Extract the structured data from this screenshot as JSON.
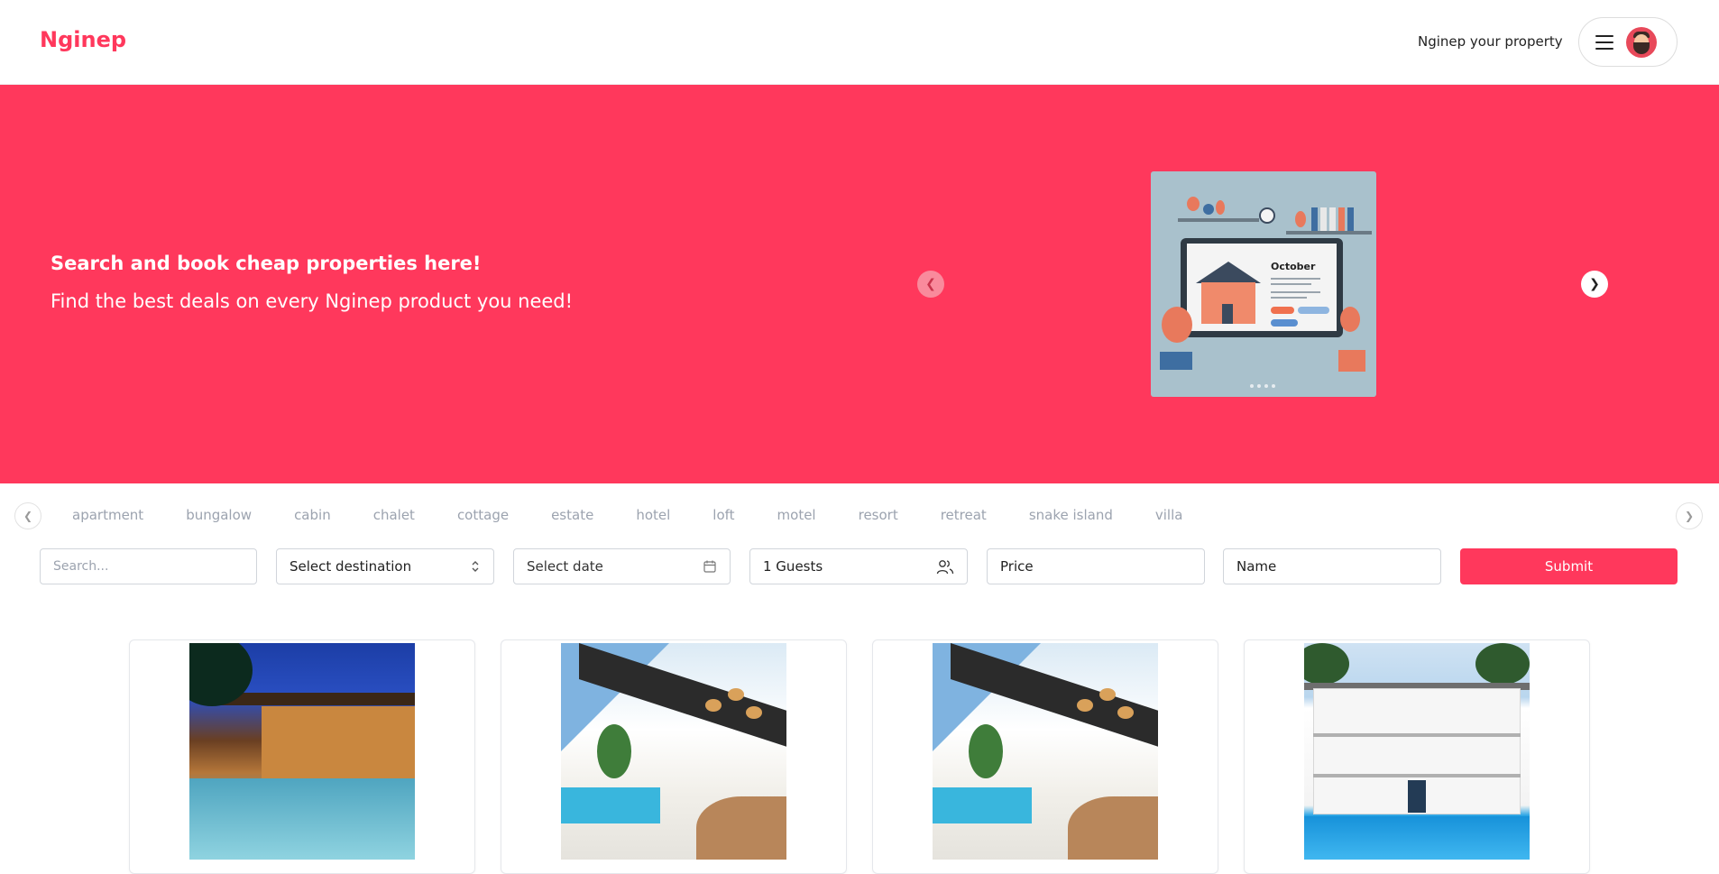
{
  "header": {
    "logo": "Nginep",
    "host_link": "Nginep your property",
    "menu_icon": "hamburger-icon",
    "avatar": "avatar"
  },
  "hero": {
    "title": "Search and book cheap properties here!",
    "subtitle": "Find the best deals on every Nginep product you need!",
    "carousel": {
      "prev_icon": "chevron-left-icon",
      "next_icon": "chevron-right-icon",
      "slide_heading": "October"
    }
  },
  "categories": {
    "items": [
      "apartment",
      "bungalow",
      "cabin",
      "chalet",
      "cottage",
      "estate",
      "hotel",
      "loft",
      "motel",
      "resort",
      "retreat",
      "snake island",
      "villa"
    ]
  },
  "filters": {
    "search_placeholder": "Search...",
    "destination": "Select destination",
    "date": "Select date",
    "guests": "1 Guests",
    "price": "Price",
    "name": "Name",
    "submit": "Submit"
  },
  "listings": [
    {
      "photo": "night-pool-villa"
    },
    {
      "photo": "white-villa-pool"
    },
    {
      "photo": "white-villa-pool"
    },
    {
      "photo": "colonial-villa-pool"
    }
  ],
  "colors": {
    "brand": "#ff385c",
    "muted_text": "#9ca3af"
  }
}
